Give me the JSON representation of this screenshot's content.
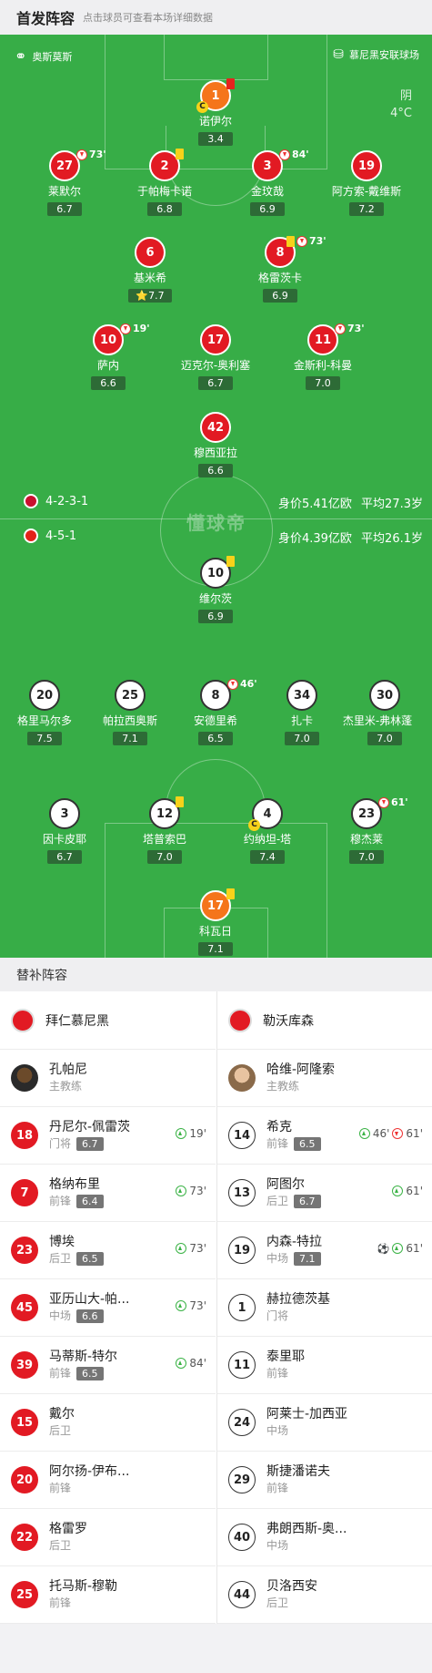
{
  "header": {
    "title": "首发阵容",
    "subtitle": "点击球员可查看本场详细数据"
  },
  "pitch": {
    "home_team_label": "奥斯莫斯",
    "stadium_label": "慕尼黑安联球场",
    "weather": "阴",
    "temperature": "4°C",
    "watermark": "懂球帝"
  },
  "bayer": {
    "formation": "4-5-1",
    "value": "身价4.39亿欧",
    "avg_age": "平均26.1岁",
    "players": [
      {
        "num": "1",
        "name": "诺伊尔",
        "rating": "3.4"
      },
      {
        "num": "27",
        "name": "莱默尔",
        "rating": "6.7",
        "sub": "73'"
      },
      {
        "num": "2",
        "name": "于帕梅卡诺",
        "rating": "6.8"
      },
      {
        "num": "3",
        "name": "金玟哉",
        "rating": "6.9",
        "sub": "84'"
      },
      {
        "num": "19",
        "name": "阿方索-戴维斯",
        "rating": "7.2"
      },
      {
        "num": "6",
        "name": "基米希",
        "rating": "7.7"
      },
      {
        "num": "8",
        "name": "格雷茨卡",
        "rating": "6.9",
        "sub": "73'"
      },
      {
        "num": "10",
        "name": "萨内",
        "rating": "6.6",
        "sub": "19'"
      },
      {
        "num": "17",
        "name": "迈克尔-奥利塞",
        "rating": "6.7"
      },
      {
        "num": "11",
        "name": "金斯利-科曼",
        "rating": "7.0",
        "sub": "73'"
      },
      {
        "num": "42",
        "name": "穆西亚拉",
        "rating": "6.6"
      }
    ]
  },
  "bayern_form": {
    "formation": "4-2-3-1",
    "value": "身价5.41亿欧",
    "avg_age": "平均27.3岁"
  },
  "leverkusen": {
    "players": [
      {
        "num": "10",
        "name": "维尔茨",
        "rating": "6.9"
      },
      {
        "num": "20",
        "name": "格里马尔多",
        "rating": "7.5"
      },
      {
        "num": "25",
        "name": "帕拉西奥斯",
        "rating": "7.1"
      },
      {
        "num": "8",
        "name": "安德里希",
        "rating": "6.5",
        "sub": "46'"
      },
      {
        "num": "34",
        "name": "扎卡",
        "rating": "7.0"
      },
      {
        "num": "30",
        "name": "杰里米-弗林蓬",
        "rating": "7.0"
      },
      {
        "num": "3",
        "name": "因卡皮耶",
        "rating": "6.7"
      },
      {
        "num": "12",
        "name": "塔普索巴",
        "rating": "7.0"
      },
      {
        "num": "4",
        "name": "约纳坦-塔",
        "rating": "7.4"
      },
      {
        "num": "23",
        "name": "穆杰莱",
        "rating": "7.0",
        "sub": "61'"
      },
      {
        "num": "17",
        "name": "科瓦日",
        "rating": "7.1"
      }
    ]
  },
  "bench": {
    "title": "替补阵容",
    "left": {
      "team": "拜仁慕尼黑",
      "coach": {
        "name": "孔帕尼",
        "role": "主教练"
      },
      "players": [
        {
          "num": "18",
          "name": "丹尼尔-佩雷茨",
          "pos": "门将",
          "rating": "6.7",
          "in": "19'"
        },
        {
          "num": "7",
          "name": "格纳布里",
          "pos": "前锋",
          "rating": "6.4",
          "in": "73'"
        },
        {
          "num": "23",
          "name": "博埃",
          "pos": "后卫",
          "rating": "6.5",
          "in": "73'"
        },
        {
          "num": "45",
          "name": "亚历山大-帕...",
          "pos": "中场",
          "rating": "6.6",
          "in": "73'"
        },
        {
          "num": "39",
          "name": "马蒂斯-特尔",
          "pos": "前锋",
          "rating": "6.5",
          "in": "84'"
        },
        {
          "num": "15",
          "name": "戴尔",
          "pos": "后卫"
        },
        {
          "num": "20",
          "name": "阿尔扬-伊布...",
          "pos": "前锋"
        },
        {
          "num": "22",
          "name": "格雷罗",
          "pos": "后卫"
        },
        {
          "num": "25",
          "name": "托马斯-穆勒",
          "pos": "前锋"
        }
      ]
    },
    "right": {
      "team": "勒沃库森",
      "coach": {
        "name": "哈维-阿隆索",
        "role": "主教练"
      },
      "players": [
        {
          "num": "14",
          "name": "希克",
          "pos": "前锋",
          "rating": "6.5",
          "in": "46'",
          "out": "61'"
        },
        {
          "num": "13",
          "name": "阿图尔",
          "pos": "后卫",
          "rating": "6.7",
          "in": "61'"
        },
        {
          "num": "19",
          "name": "内森-特拉",
          "pos": "中场",
          "rating": "7.1",
          "in": "61'",
          "goal": "⚽"
        },
        {
          "num": "1",
          "name": "赫拉德茨基",
          "pos": "门将"
        },
        {
          "num": "11",
          "name": "泰里耶",
          "pos": "前锋"
        },
        {
          "num": "24",
          "name": "阿莱士-加西亚",
          "pos": "中场"
        },
        {
          "num": "29",
          "name": "斯捷潘诺夫",
          "pos": "前锋"
        },
        {
          "num": "40",
          "name": "弗朗西斯-奥...",
          "pos": "中场"
        },
        {
          "num": "44",
          "name": "贝洛西安",
          "pos": "后卫"
        }
      ]
    }
  },
  "colors": {
    "pitch": "#37ad47",
    "home": "#e21a23",
    "keeper": "#f5751b",
    "yellow": "#f7d21a"
  }
}
